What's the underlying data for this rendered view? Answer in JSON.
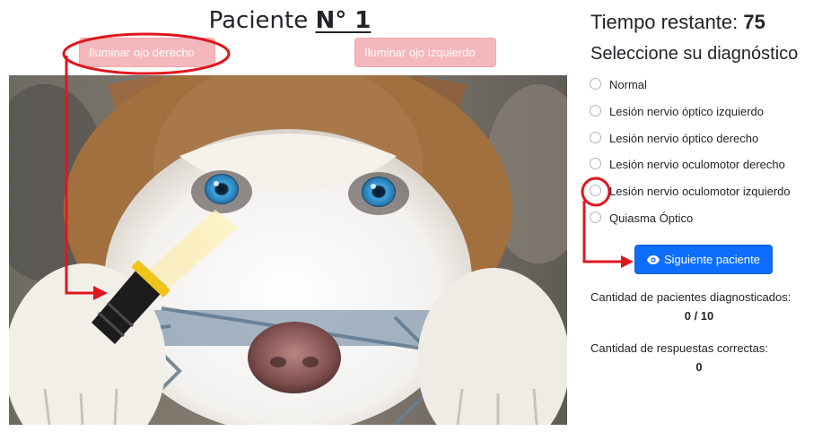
{
  "patient": {
    "title_prefix": "Paciente",
    "number": "N° 1"
  },
  "buttons": {
    "light_right_eye": "Iluminar ojo derecho",
    "light_left_eye": "Iluminar ojo izquierdo",
    "next_patient": "Siguiente paciente"
  },
  "timer": {
    "label": "Tiempo restante:",
    "value": "75"
  },
  "diagnosis": {
    "title": "Seleccione su diagnóstico",
    "options": [
      "Normal",
      "Lesión nervio óptico izquierdo",
      "Lesión nervio óptico derecho",
      "Lesión nervio oculomotor derecho",
      "Lesión nervio oculomotor izquierdo",
      "Quiasma Óptico"
    ]
  },
  "stats": {
    "diagnosed_label": "Cantidad de pacientes diagnosticados:",
    "diagnosed_value": "0 / 10",
    "correct_label": "Cantidad de respuestas correctas:",
    "correct_value": "0"
  },
  "icons": {
    "next_button": "eye-icon",
    "tool": "flashlight-icon"
  },
  "colors": {
    "primary": "#0d6efd",
    "danger_light": "#f4b7bc",
    "annotation": "#e0161f",
    "iris": "#2f8fd0"
  }
}
